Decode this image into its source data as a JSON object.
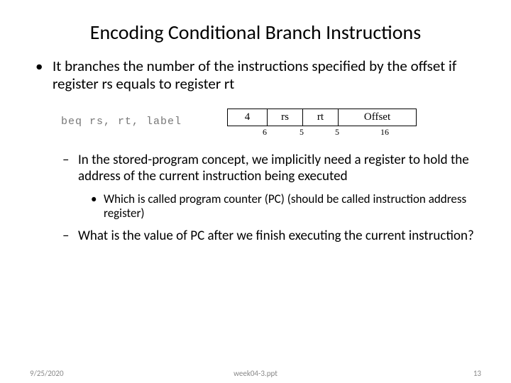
{
  "title": "Encoding Conditional Branch Instructions",
  "bullets": {
    "l1": "It branches the number of the instructions specified by the offset if register rs equals to register rt",
    "l2a": "In the stored-program concept, we implicitly need a register to hold the address of the current instruction being executed",
    "l3": "Which is called program counter (PC) (should be called instruction address register)",
    "l2b": "What is the value of PC after we finish executing the current instruction?"
  },
  "diagram": {
    "code": "beq rs, rt, label",
    "fields": {
      "op": "4",
      "rs": "rs",
      "rt": "rt",
      "off": "Offset"
    },
    "bits": {
      "op": "6",
      "rs": "5",
      "rt": "5",
      "off": "16"
    }
  },
  "footer": {
    "date": "9/25/2020",
    "file": "week04-3.ppt",
    "num": "13"
  }
}
